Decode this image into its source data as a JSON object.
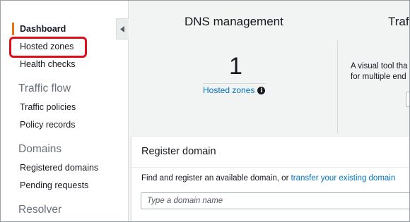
{
  "sidebar": {
    "items": [
      {
        "label": "Dashboard",
        "active": true
      },
      {
        "label": "Hosted zones",
        "highlighted": true
      },
      {
        "label": "Health checks"
      }
    ],
    "sections": [
      {
        "heading": "Traffic flow",
        "items": [
          "Traffic policies",
          "Policy records"
        ]
      },
      {
        "heading": "Domains",
        "items": [
          "Registered domains",
          "Pending requests"
        ]
      },
      {
        "heading": "Resolver",
        "items": []
      }
    ],
    "collapse_icon": "caret-left-icon"
  },
  "dns_management": {
    "title": "DNS management",
    "hosted_zone_count": "1",
    "hosted_zones_link": "Hosted zones",
    "info_icon": "info-icon"
  },
  "traffic_flow": {
    "title": "Traf",
    "description_line1": "A visual tool tha",
    "description_line2": "for multiple end"
  },
  "register_domain": {
    "title": "Register domain",
    "description_prefix": "Find and register an available domain, or ",
    "transfer_link": "transfer your existing domain",
    "input_placeholder": "Type a domain name"
  },
  "colors": {
    "accent": "#ec7211",
    "highlight": "#e00d1a",
    "link": "#0073bb"
  }
}
